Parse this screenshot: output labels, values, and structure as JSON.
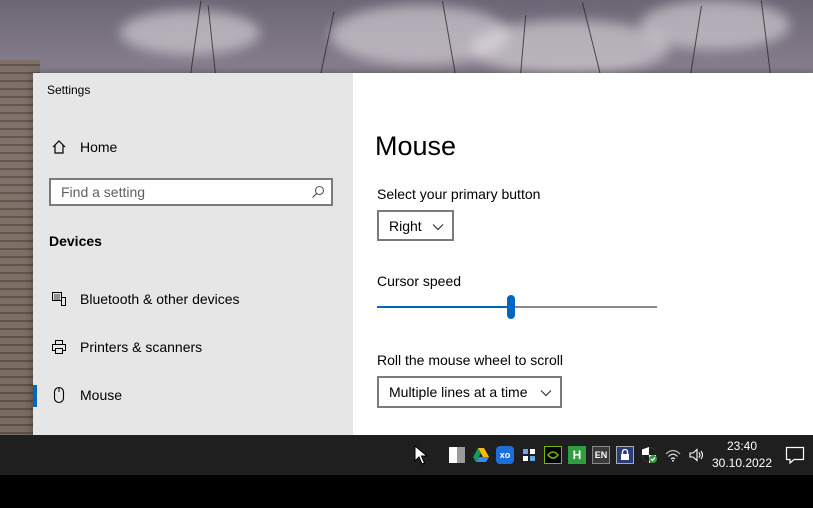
{
  "window": {
    "title": "Settings"
  },
  "sidebar": {
    "home_label": "Home",
    "search_placeholder": "Find a setting",
    "section_title": "Devices",
    "items": [
      {
        "label": "Bluetooth & other devices",
        "icon": "bluetooth-device-icon"
      },
      {
        "label": "Printers & scanners",
        "icon": "printer-icon"
      },
      {
        "label": "Mouse",
        "icon": "mouse-icon",
        "active": true
      }
    ]
  },
  "main": {
    "title": "Mouse",
    "primary_button": {
      "label": "Select your primary button",
      "value": "Right"
    },
    "cursor_speed": {
      "label": "Cursor speed",
      "value_fraction": 0.48
    },
    "scroll": {
      "label": "Roll the mouse wheel to scroll",
      "value": "Multiple lines at a time"
    }
  },
  "taskbar": {
    "tray_icons": [
      "app-icon",
      "google-drive-icon",
      "xo-icon",
      "app-icon",
      "nvidia-icon",
      "h-app-icon",
      "language-icon",
      "vpn-lock-icon",
      "defender-icon",
      "wifi-icon",
      "volume-icon"
    ],
    "language": "EN",
    "time": "23:40",
    "date": "30.10.2022"
  },
  "colors": {
    "accent": "#0067c0",
    "sidebar_bg": "#e6e6e6",
    "taskbar_bg": "#1f1f1f"
  }
}
